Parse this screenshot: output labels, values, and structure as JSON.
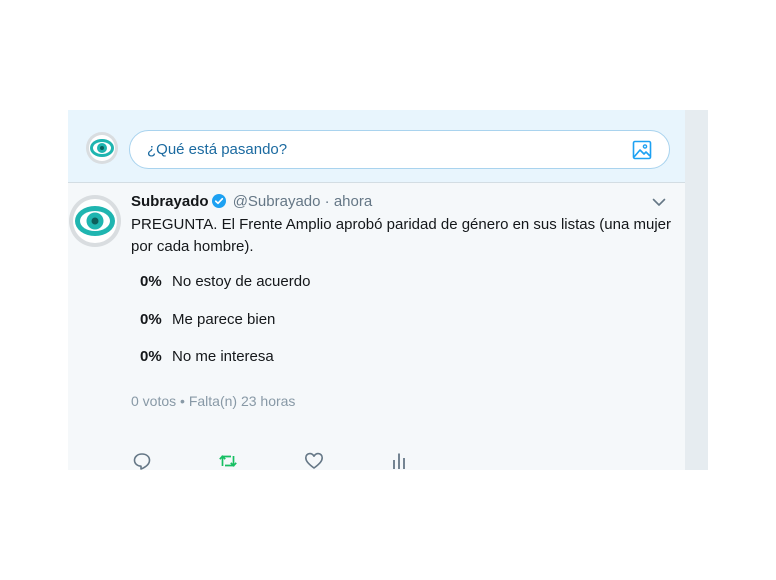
{
  "compose": {
    "placeholder": "¿Qué está pasando?",
    "avatar_icon": "subrayado-eye-logo",
    "media_icon": "image-icon"
  },
  "tweet": {
    "author_name": "Subrayado",
    "handle": "@Subrayado",
    "separator": "·",
    "time": "ahora",
    "verified": true,
    "text": "PREGUNTA. El Frente Amplio aprobó paridad de género en sus listas (una mujer por cada hombre).",
    "poll": {
      "options": [
        {
          "percent": "0%",
          "label": "No estoy de acuerdo"
        },
        {
          "percent": "0%",
          "label": "Me parece bien"
        },
        {
          "percent": "0%",
          "label": "No me interesa"
        }
      ],
      "votes": "0 votos",
      "bullet": "•",
      "remaining": "Falta(n) 23 horas"
    },
    "actions": [
      "reply-icon",
      "retweet-icon",
      "like-icon",
      "analytics-icon"
    ]
  },
  "colors": {
    "accent": "#1da1f2",
    "link": "#1b6aa0",
    "retweet": "#17bf63",
    "secondary_text": "#657786",
    "compose_background": "#e8f5fd",
    "tweet_background": "#f5f8fa"
  }
}
